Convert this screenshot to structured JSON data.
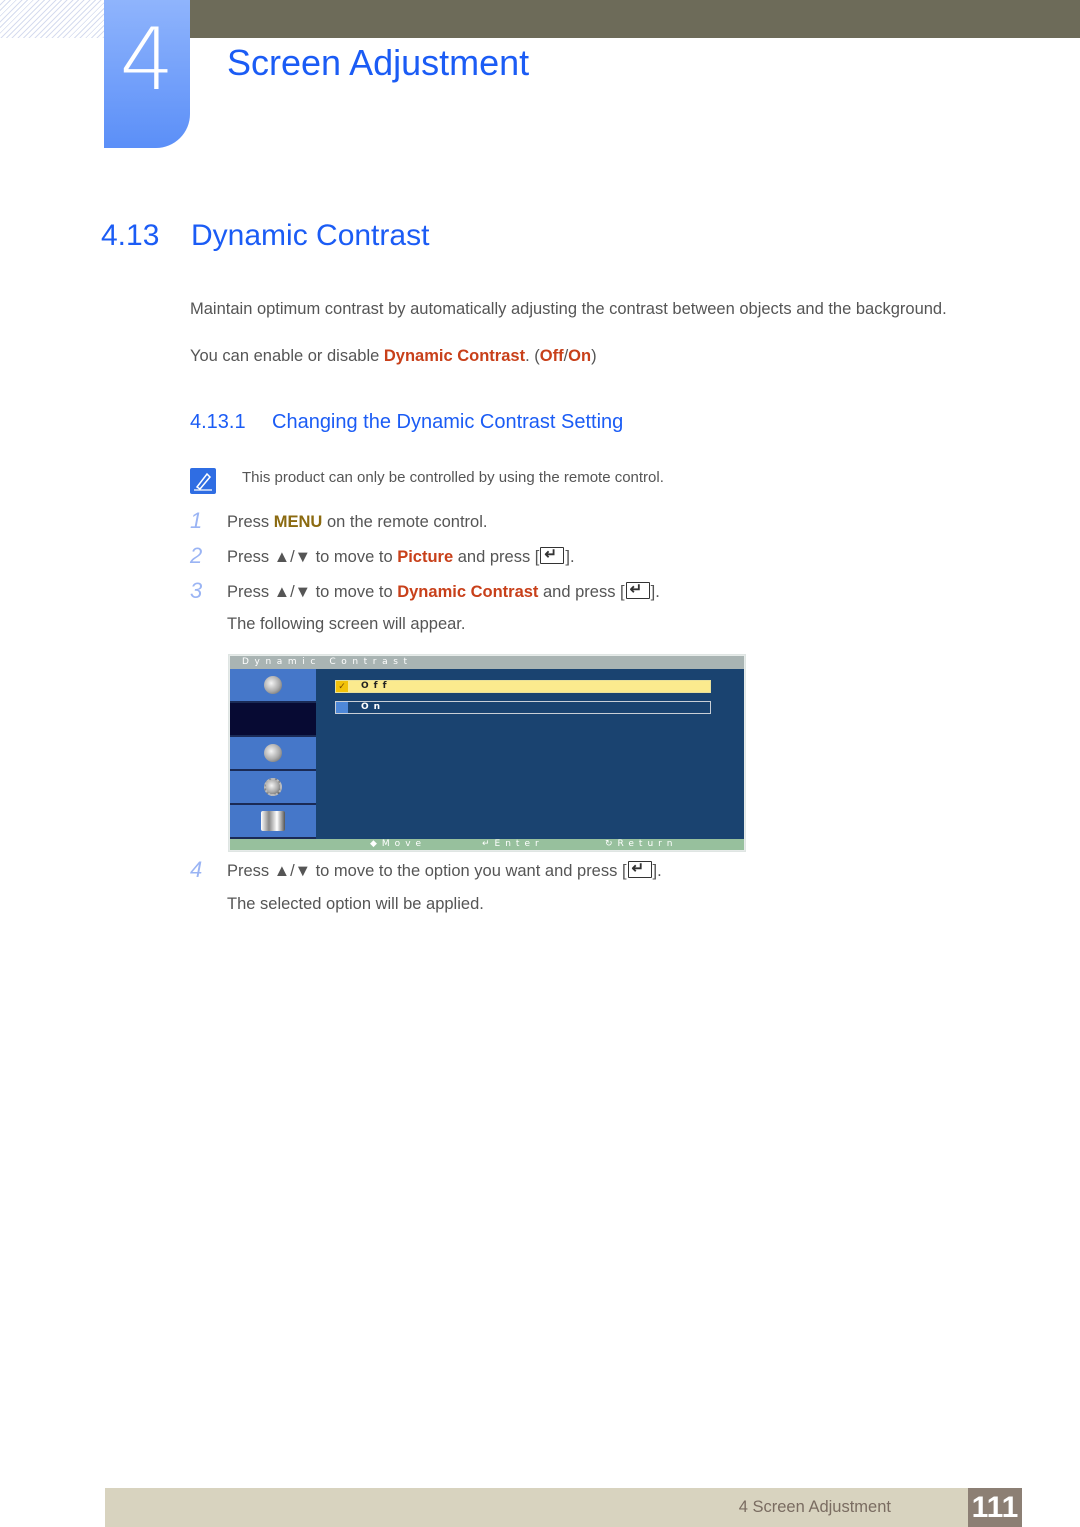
{
  "chapter": {
    "number": "4",
    "title": "Screen Adjustment"
  },
  "section": {
    "number": "4.13",
    "title": "Dynamic Contrast"
  },
  "intro": {
    "line1": "Maintain optimum contrast by automatically adjusting the contrast between objects and the background.",
    "line2_prefix": "You can enable or disable ",
    "line2_term": "Dynamic Contrast",
    "line2_mid": ". (",
    "line2_off": "Off",
    "line2_slash": "/",
    "line2_on": "On",
    "line2_suffix": ")"
  },
  "subsection": {
    "number": "4.13.1",
    "title": "Changing the Dynamic Contrast Setting"
  },
  "note": {
    "icon": "note-pencil-icon",
    "text": "This product can only be controlled by using the remote control."
  },
  "steps": [
    {
      "num": "1",
      "pre": "Press ",
      "key": "MENU",
      "post": " on the remote control."
    },
    {
      "num": "2",
      "pre": "Press ▲/▼ to move to ",
      "key": "Picture",
      "post": " and press [",
      "end": "]."
    },
    {
      "num": "3",
      "pre": "Press ▲/▼ to move to ",
      "key": "Dynamic Contrast",
      "post": " and press [",
      "end": "].",
      "sub": "The following screen will appear."
    },
    {
      "num": "4",
      "pre": "Press ▲/▼ to move to the option you want and press [",
      "end": "].",
      "sub": "The selected option will be applied."
    }
  ],
  "osd": {
    "title": "Dynamic Contrast",
    "options": [
      {
        "label": "Off",
        "selected": true,
        "mark": "✓"
      },
      {
        "label": "On",
        "selected": false
      }
    ],
    "footer": {
      "move": "◆Move",
      "enter": "↵Enter",
      "return": "↻Return"
    }
  },
  "footer": {
    "chapter_label": "4 Screen Adjustment",
    "page_number": "111"
  }
}
